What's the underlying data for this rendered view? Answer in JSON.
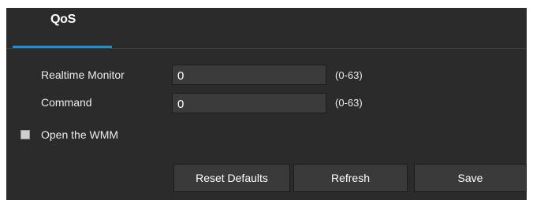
{
  "tabs": [
    {
      "label": "QoS",
      "active": true
    }
  ],
  "accent_color": "#1a8fd8",
  "form": {
    "realtime_monitor": {
      "label": "Realtime Monitor",
      "value": "0",
      "range": "(0-63)"
    },
    "command": {
      "label": "Command",
      "value": "0",
      "range": "(0-63)"
    },
    "wmm": {
      "label": "Open the WMM",
      "checked": false
    }
  },
  "buttons": {
    "reset_defaults": "Reset Defaults",
    "refresh": "Refresh",
    "save": "Save"
  }
}
